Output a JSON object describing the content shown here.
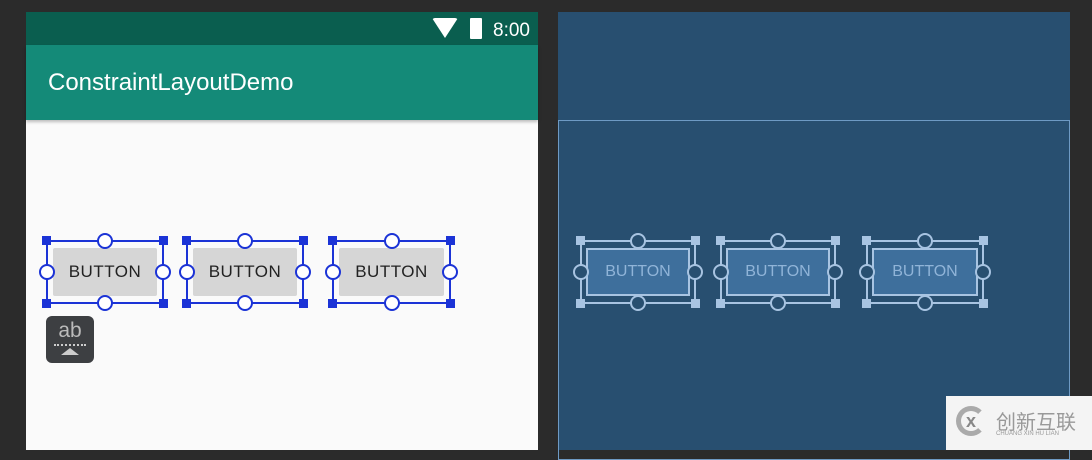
{
  "status_bar": {
    "time": "8:00"
  },
  "app_bar": {
    "title": "ConstraintLayoutDemo"
  },
  "design": {
    "buttons": [
      "BUTTON",
      "BUTTON",
      "BUTTON"
    ],
    "text_tool_label": "ab"
  },
  "blueprint": {
    "buttons": [
      "BUTTON",
      "BUTTON",
      "BUTTON"
    ]
  },
  "watermark": {
    "name": "创新互联",
    "pinyin": "CHUANG XIN HU LIAN"
  },
  "colors": {
    "status": "#0a5e4f",
    "appbar": "#148a78",
    "selection": "#1b33d6",
    "blueprint": "#284f70"
  }
}
